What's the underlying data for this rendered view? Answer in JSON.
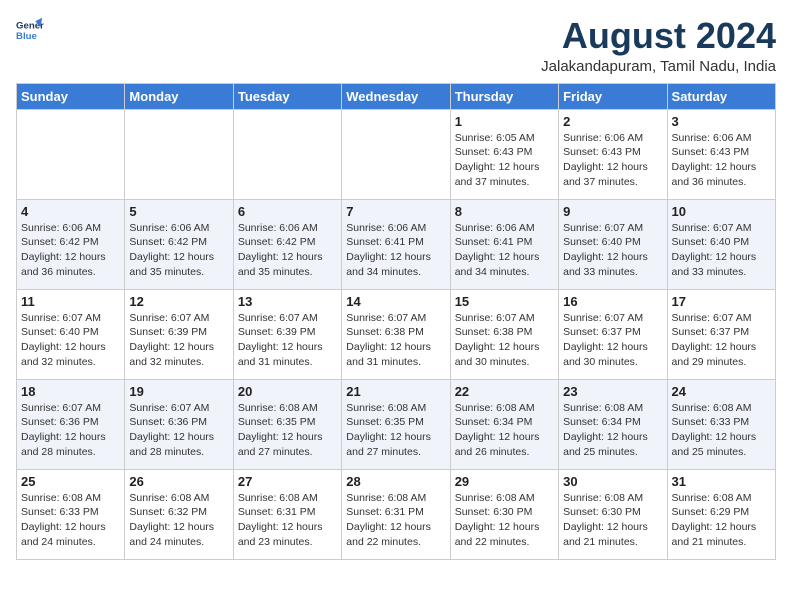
{
  "header": {
    "logo_line1": "General",
    "logo_line2": "Blue",
    "month_year": "August 2024",
    "location": "Jalakandapuram, Tamil Nadu, India"
  },
  "days_of_week": [
    "Sunday",
    "Monday",
    "Tuesday",
    "Wednesday",
    "Thursday",
    "Friday",
    "Saturday"
  ],
  "weeks": [
    [
      {
        "day": "",
        "info": ""
      },
      {
        "day": "",
        "info": ""
      },
      {
        "day": "",
        "info": ""
      },
      {
        "day": "",
        "info": ""
      },
      {
        "day": "1",
        "info": "Sunrise: 6:05 AM\nSunset: 6:43 PM\nDaylight: 12 hours\nand 37 minutes."
      },
      {
        "day": "2",
        "info": "Sunrise: 6:06 AM\nSunset: 6:43 PM\nDaylight: 12 hours\nand 37 minutes."
      },
      {
        "day": "3",
        "info": "Sunrise: 6:06 AM\nSunset: 6:43 PM\nDaylight: 12 hours\nand 36 minutes."
      }
    ],
    [
      {
        "day": "4",
        "info": "Sunrise: 6:06 AM\nSunset: 6:42 PM\nDaylight: 12 hours\nand 36 minutes."
      },
      {
        "day": "5",
        "info": "Sunrise: 6:06 AM\nSunset: 6:42 PM\nDaylight: 12 hours\nand 35 minutes."
      },
      {
        "day": "6",
        "info": "Sunrise: 6:06 AM\nSunset: 6:42 PM\nDaylight: 12 hours\nand 35 minutes."
      },
      {
        "day": "7",
        "info": "Sunrise: 6:06 AM\nSunset: 6:41 PM\nDaylight: 12 hours\nand 34 minutes."
      },
      {
        "day": "8",
        "info": "Sunrise: 6:06 AM\nSunset: 6:41 PM\nDaylight: 12 hours\nand 34 minutes."
      },
      {
        "day": "9",
        "info": "Sunrise: 6:07 AM\nSunset: 6:40 PM\nDaylight: 12 hours\nand 33 minutes."
      },
      {
        "day": "10",
        "info": "Sunrise: 6:07 AM\nSunset: 6:40 PM\nDaylight: 12 hours\nand 33 minutes."
      }
    ],
    [
      {
        "day": "11",
        "info": "Sunrise: 6:07 AM\nSunset: 6:40 PM\nDaylight: 12 hours\nand 32 minutes."
      },
      {
        "day": "12",
        "info": "Sunrise: 6:07 AM\nSunset: 6:39 PM\nDaylight: 12 hours\nand 32 minutes."
      },
      {
        "day": "13",
        "info": "Sunrise: 6:07 AM\nSunset: 6:39 PM\nDaylight: 12 hours\nand 31 minutes."
      },
      {
        "day": "14",
        "info": "Sunrise: 6:07 AM\nSunset: 6:38 PM\nDaylight: 12 hours\nand 31 minutes."
      },
      {
        "day": "15",
        "info": "Sunrise: 6:07 AM\nSunset: 6:38 PM\nDaylight: 12 hours\nand 30 minutes."
      },
      {
        "day": "16",
        "info": "Sunrise: 6:07 AM\nSunset: 6:37 PM\nDaylight: 12 hours\nand 30 minutes."
      },
      {
        "day": "17",
        "info": "Sunrise: 6:07 AM\nSunset: 6:37 PM\nDaylight: 12 hours\nand 29 minutes."
      }
    ],
    [
      {
        "day": "18",
        "info": "Sunrise: 6:07 AM\nSunset: 6:36 PM\nDaylight: 12 hours\nand 28 minutes."
      },
      {
        "day": "19",
        "info": "Sunrise: 6:07 AM\nSunset: 6:36 PM\nDaylight: 12 hours\nand 28 minutes."
      },
      {
        "day": "20",
        "info": "Sunrise: 6:08 AM\nSunset: 6:35 PM\nDaylight: 12 hours\nand 27 minutes."
      },
      {
        "day": "21",
        "info": "Sunrise: 6:08 AM\nSunset: 6:35 PM\nDaylight: 12 hours\nand 27 minutes."
      },
      {
        "day": "22",
        "info": "Sunrise: 6:08 AM\nSunset: 6:34 PM\nDaylight: 12 hours\nand 26 minutes."
      },
      {
        "day": "23",
        "info": "Sunrise: 6:08 AM\nSunset: 6:34 PM\nDaylight: 12 hours\nand 25 minutes."
      },
      {
        "day": "24",
        "info": "Sunrise: 6:08 AM\nSunset: 6:33 PM\nDaylight: 12 hours\nand 25 minutes."
      }
    ],
    [
      {
        "day": "25",
        "info": "Sunrise: 6:08 AM\nSunset: 6:33 PM\nDaylight: 12 hours\nand 24 minutes."
      },
      {
        "day": "26",
        "info": "Sunrise: 6:08 AM\nSunset: 6:32 PM\nDaylight: 12 hours\nand 24 minutes."
      },
      {
        "day": "27",
        "info": "Sunrise: 6:08 AM\nSunset: 6:31 PM\nDaylight: 12 hours\nand 23 minutes."
      },
      {
        "day": "28",
        "info": "Sunrise: 6:08 AM\nSunset: 6:31 PM\nDaylight: 12 hours\nand 22 minutes."
      },
      {
        "day": "29",
        "info": "Sunrise: 6:08 AM\nSunset: 6:30 PM\nDaylight: 12 hours\nand 22 minutes."
      },
      {
        "day": "30",
        "info": "Sunrise: 6:08 AM\nSunset: 6:30 PM\nDaylight: 12 hours\nand 21 minutes."
      },
      {
        "day": "31",
        "info": "Sunrise: 6:08 AM\nSunset: 6:29 PM\nDaylight: 12 hours\nand 21 minutes."
      }
    ]
  ]
}
